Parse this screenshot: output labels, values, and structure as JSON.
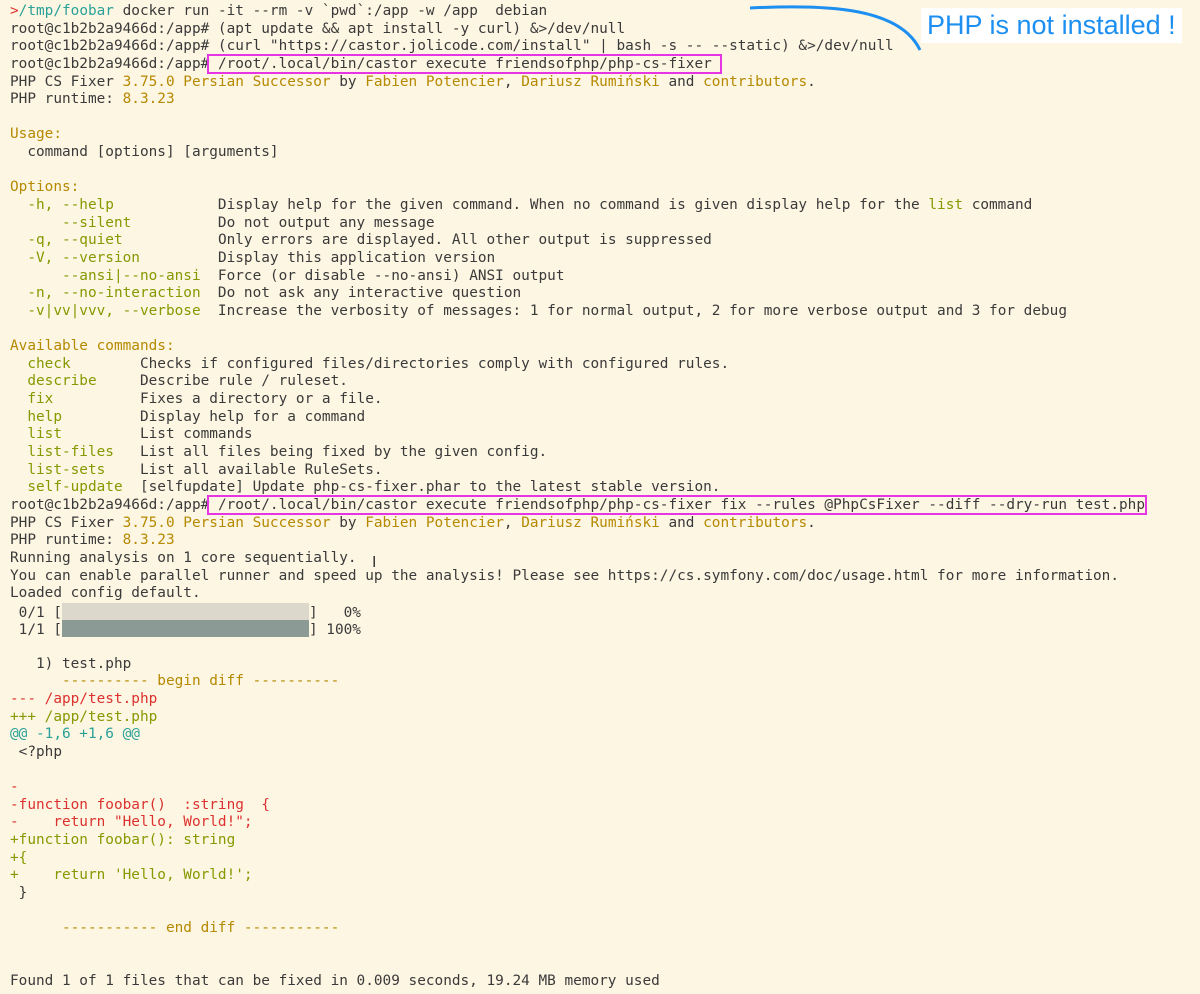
{
  "annotation": {
    "text": "PHP is not installed !",
    "color": "#1d8ff0"
  },
  "colors": {
    "background": "#fdf6e3",
    "text": "#3a3a3a",
    "highlight_box": "#e535e5",
    "gold": "#b58900",
    "red": "#dc322f",
    "green": "#859900"
  },
  "lines": [
    {
      "segs": [
        {
          "t": ">",
          "c": "red"
        },
        {
          "t": "/tmp/foobar",
          "c": "cyan"
        },
        {
          "t": " docker run -it --rm -v `pwd`:/app -w /app  debian",
          "c": ""
        }
      ]
    },
    {
      "segs": [
        {
          "t": "root@c1b2b2a9466d:/app# (apt update && apt install -y curl) &>/dev/null",
          "c": ""
        }
      ]
    },
    {
      "segs": [
        {
          "t": "root@c1b2b2a9466d:/app# (curl \"https://castor.jolicode.com/install\" | bash -s -- --static) &>/dev/null",
          "c": ""
        }
      ]
    },
    {
      "segs": [
        {
          "t": "root@c1b2b2a9466d:/app#",
          "c": ""
        },
        {
          "t": " /root/.local/bin/castor execute friendsofphp/php-cs-fixer ",
          "c": "",
          "hl": true
        }
      ]
    },
    {
      "segs": [
        {
          "t": "PHP CS Fixer ",
          "c": ""
        },
        {
          "t": "3.75.0 Persian Successor",
          "c": "gold"
        },
        {
          "t": " by ",
          "c": ""
        },
        {
          "t": "Fabien Potencier",
          "c": "gold"
        },
        {
          "t": ", ",
          "c": ""
        },
        {
          "t": "Dariusz Rumiński",
          "c": "gold"
        },
        {
          "t": " and ",
          "c": ""
        },
        {
          "t": "contributors",
          "c": "gold"
        },
        {
          "t": ".",
          "c": ""
        }
      ]
    },
    {
      "segs": [
        {
          "t": "PHP runtime: ",
          "c": ""
        },
        {
          "t": "8.3.23",
          "c": "gold"
        }
      ]
    },
    {
      "segs": [
        {
          "t": "",
          "c": ""
        }
      ]
    },
    {
      "segs": [
        {
          "t": "Usage:",
          "c": "gold"
        }
      ]
    },
    {
      "segs": [
        {
          "t": "  command [options] [arguments]",
          "c": ""
        }
      ]
    },
    {
      "segs": [
        {
          "t": "",
          "c": ""
        }
      ]
    },
    {
      "segs": [
        {
          "t": "Options:",
          "c": "gold"
        }
      ]
    },
    {
      "segs": [
        {
          "t": "  -h, --help",
          "c": "green"
        },
        {
          "t": "            Display help for the given command. When no command is given display help for the ",
          "c": ""
        },
        {
          "t": "list",
          "c": "green"
        },
        {
          "t": " command",
          "c": ""
        }
      ]
    },
    {
      "segs": [
        {
          "t": "      --silent",
          "c": "green"
        },
        {
          "t": "          Do not output any message",
          "c": ""
        }
      ]
    },
    {
      "segs": [
        {
          "t": "  -q, --quiet",
          "c": "green"
        },
        {
          "t": "           Only errors are displayed. All other output is suppressed",
          "c": ""
        }
      ]
    },
    {
      "segs": [
        {
          "t": "  -V, --version",
          "c": "green"
        },
        {
          "t": "         Display this application version",
          "c": ""
        }
      ]
    },
    {
      "segs": [
        {
          "t": "      --ansi|--no-ansi",
          "c": "green"
        },
        {
          "t": "  Force (or disable --no-ansi) ANSI output",
          "c": ""
        }
      ]
    },
    {
      "segs": [
        {
          "t": "  -n, --no-interaction",
          "c": "green"
        },
        {
          "t": "  Do not ask any interactive question",
          "c": ""
        }
      ]
    },
    {
      "segs": [
        {
          "t": "  -v|vv|vvv, --verbose",
          "c": "green"
        },
        {
          "t": "  Increase the verbosity of messages: 1 for normal output, 2 for more verbose output and 3 for debug",
          "c": ""
        }
      ]
    },
    {
      "segs": [
        {
          "t": "",
          "c": ""
        }
      ]
    },
    {
      "segs": [
        {
          "t": "Available commands:",
          "c": "gold"
        }
      ]
    },
    {
      "segs": [
        {
          "t": "  check",
          "c": "green"
        },
        {
          "t": "        Checks if configured files/directories comply with configured rules.",
          "c": ""
        }
      ]
    },
    {
      "segs": [
        {
          "t": "  describe",
          "c": "green"
        },
        {
          "t": "     Describe rule / ruleset.",
          "c": ""
        }
      ]
    },
    {
      "segs": [
        {
          "t": "  fix",
          "c": "green"
        },
        {
          "t": "          Fixes a directory or a file.",
          "c": ""
        }
      ]
    },
    {
      "segs": [
        {
          "t": "  help",
          "c": "green"
        },
        {
          "t": "         Display help for a command",
          "c": ""
        }
      ]
    },
    {
      "segs": [
        {
          "t": "  list",
          "c": "green"
        },
        {
          "t": "         List commands",
          "c": ""
        }
      ]
    },
    {
      "segs": [
        {
          "t": "  list-files",
          "c": "green"
        },
        {
          "t": "   List all files being fixed by the given config.",
          "c": ""
        }
      ]
    },
    {
      "segs": [
        {
          "t": "  list-sets",
          "c": "green"
        },
        {
          "t": "    List all available RuleSets.",
          "c": ""
        }
      ]
    },
    {
      "segs": [
        {
          "t": "  self-update",
          "c": "green"
        },
        {
          "t": "  [selfupdate] Update php-cs-fixer.phar to the latest stable version.",
          "c": ""
        }
      ]
    },
    {
      "segs": [
        {
          "t": "root@c1b2b2a9466d:/app#",
          "c": ""
        },
        {
          "t": " /root/.local/bin/castor execute friendsofphp/php-cs-fixer fix --rules @PhpCsFixer --diff --dry-run test.php",
          "c": "",
          "hl": true
        }
      ]
    },
    {
      "segs": [
        {
          "t": "PHP CS Fixer ",
          "c": ""
        },
        {
          "t": "3.75.0 Persian Successor",
          "c": "gold"
        },
        {
          "t": " by ",
          "c": ""
        },
        {
          "t": "Fabien Potencier",
          "c": "gold"
        },
        {
          "t": ", ",
          "c": ""
        },
        {
          "t": "Dariusz Rumiński",
          "c": "gold"
        },
        {
          "t": " and ",
          "c": ""
        },
        {
          "t": "contributors",
          "c": "gold"
        },
        {
          "t": ".",
          "c": ""
        }
      ]
    },
    {
      "segs": [
        {
          "t": "PHP runtime: ",
          "c": ""
        },
        {
          "t": "8.3.23",
          "c": "gold"
        }
      ]
    },
    {
      "segs": [
        {
          "t": "Running analysis on 1 core sequentially.",
          "c": ""
        }
      ]
    },
    {
      "segs": [
        {
          "t": "You can enable parallel runner and speed up the analysis! Please see https://cs.symfony.com/doc/usage.html for more information.",
          "c": ""
        }
      ]
    },
    {
      "segs": [
        {
          "t": "Loaded config default.",
          "c": ""
        }
      ]
    },
    {
      "progress": {
        "label": " 0/1 [",
        "state": "empty",
        "pct": "]   0%"
      }
    },
    {
      "progress": {
        "label": " 1/1 [",
        "state": "full",
        "pct": "] 100%"
      }
    },
    {
      "segs": [
        {
          "t": "",
          "c": ""
        }
      ]
    },
    {
      "segs": [
        {
          "t": "   1) test.php",
          "c": ""
        }
      ]
    },
    {
      "segs": [
        {
          "t": "      ---------- begin diff ----------",
          "c": "gold"
        }
      ]
    },
    {
      "segs": [
        {
          "t": "--- /app/test.php",
          "c": "red"
        }
      ]
    },
    {
      "segs": [
        {
          "t": "+++ /app/test.php",
          "c": "green"
        }
      ]
    },
    {
      "segs": [
        {
          "t": "@@ -1,6 +1,6 @@",
          "c": "cyan"
        }
      ]
    },
    {
      "segs": [
        {
          "t": " <?php",
          "c": ""
        }
      ]
    },
    {
      "segs": [
        {
          "t": "",
          "c": ""
        }
      ]
    },
    {
      "segs": [
        {
          "t": "-",
          "c": "red"
        }
      ]
    },
    {
      "segs": [
        {
          "t": "-function foobar()  :string  {",
          "c": "red"
        }
      ]
    },
    {
      "segs": [
        {
          "t": "-    return \"Hello, World!\";",
          "c": "red"
        }
      ]
    },
    {
      "segs": [
        {
          "t": "+function foobar(): string",
          "c": "green"
        }
      ]
    },
    {
      "segs": [
        {
          "t": "+{",
          "c": "green"
        }
      ]
    },
    {
      "segs": [
        {
          "t": "+    return 'Hello, World!';",
          "c": "green"
        }
      ]
    },
    {
      "segs": [
        {
          "t": " }",
          "c": ""
        }
      ]
    },
    {
      "segs": [
        {
          "t": "",
          "c": ""
        }
      ]
    },
    {
      "segs": [
        {
          "t": "      ----------- end diff -----------",
          "c": "gold"
        }
      ]
    },
    {
      "segs": [
        {
          "t": "",
          "c": ""
        }
      ]
    },
    {
      "segs": [
        {
          "t": "",
          "c": ""
        }
      ]
    },
    {
      "segs": [
        {
          "t": "Found 1 of 1 files that can be fixed in 0.009 seconds, 19.24 MB memory used",
          "c": ""
        }
      ]
    }
  ]
}
